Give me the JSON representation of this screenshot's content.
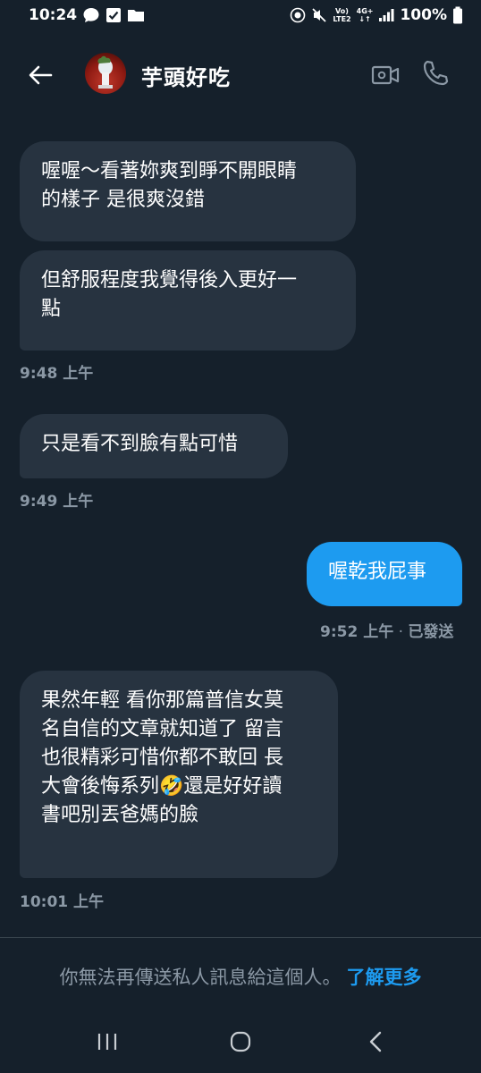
{
  "status_bar": {
    "time": "10:24",
    "net_label_1": "Vo)\nLTE2",
    "net_label_2": "4G+\n↓↑",
    "battery": "100%"
  },
  "header": {
    "contact_name": "芋頭好吃"
  },
  "messages": [
    {
      "direction": "in",
      "text_lines": [
        "喔喔～看著妳爽到睜不開眼睛",
        "的樣子 是很爽沒錯"
      ]
    },
    {
      "direction": "in",
      "text_lines": [
        "但舒服程度我覺得後入更好一",
        "點"
      ],
      "time": "9:48 上午"
    },
    {
      "direction": "in",
      "text_lines": [
        "只是看不到臉有點可惜"
      ],
      "time": "9:49 上午"
    },
    {
      "direction": "out",
      "text_lines": [
        "喔乾我屁事"
      ],
      "time": "9:52 上午",
      "status": "已發送"
    },
    {
      "direction": "in",
      "text_lines": [
        "果然年輕 看你那篇普信女莫",
        "名自信的文章就知道了 留言",
        "也很精彩可惜你都不敢回 長",
        "大會後悔系列🤣還是好好讀",
        "書吧別丟爸媽的臉"
      ],
      "time": "10:01 上午"
    }
  ],
  "footer": {
    "notice": "你無法再傳送私人訊息給這個人。",
    "learn_more": "了解更多"
  },
  "colors": {
    "background": "#15202b",
    "incoming_bubble": "#273340",
    "outgoing_bubble": "#1d9bf0",
    "accent": "#1d9bf0",
    "muted_text": "#8b98a5"
  },
  "icons": [
    "chat-bubble-icon",
    "checkbox-icon",
    "folder-icon",
    "battery-saver-icon",
    "mute-icon",
    "signal-icon",
    "back-arrow-icon",
    "video-call-icon",
    "phone-icon",
    "recent-apps-icon",
    "home-icon",
    "back-nav-icon"
  ]
}
